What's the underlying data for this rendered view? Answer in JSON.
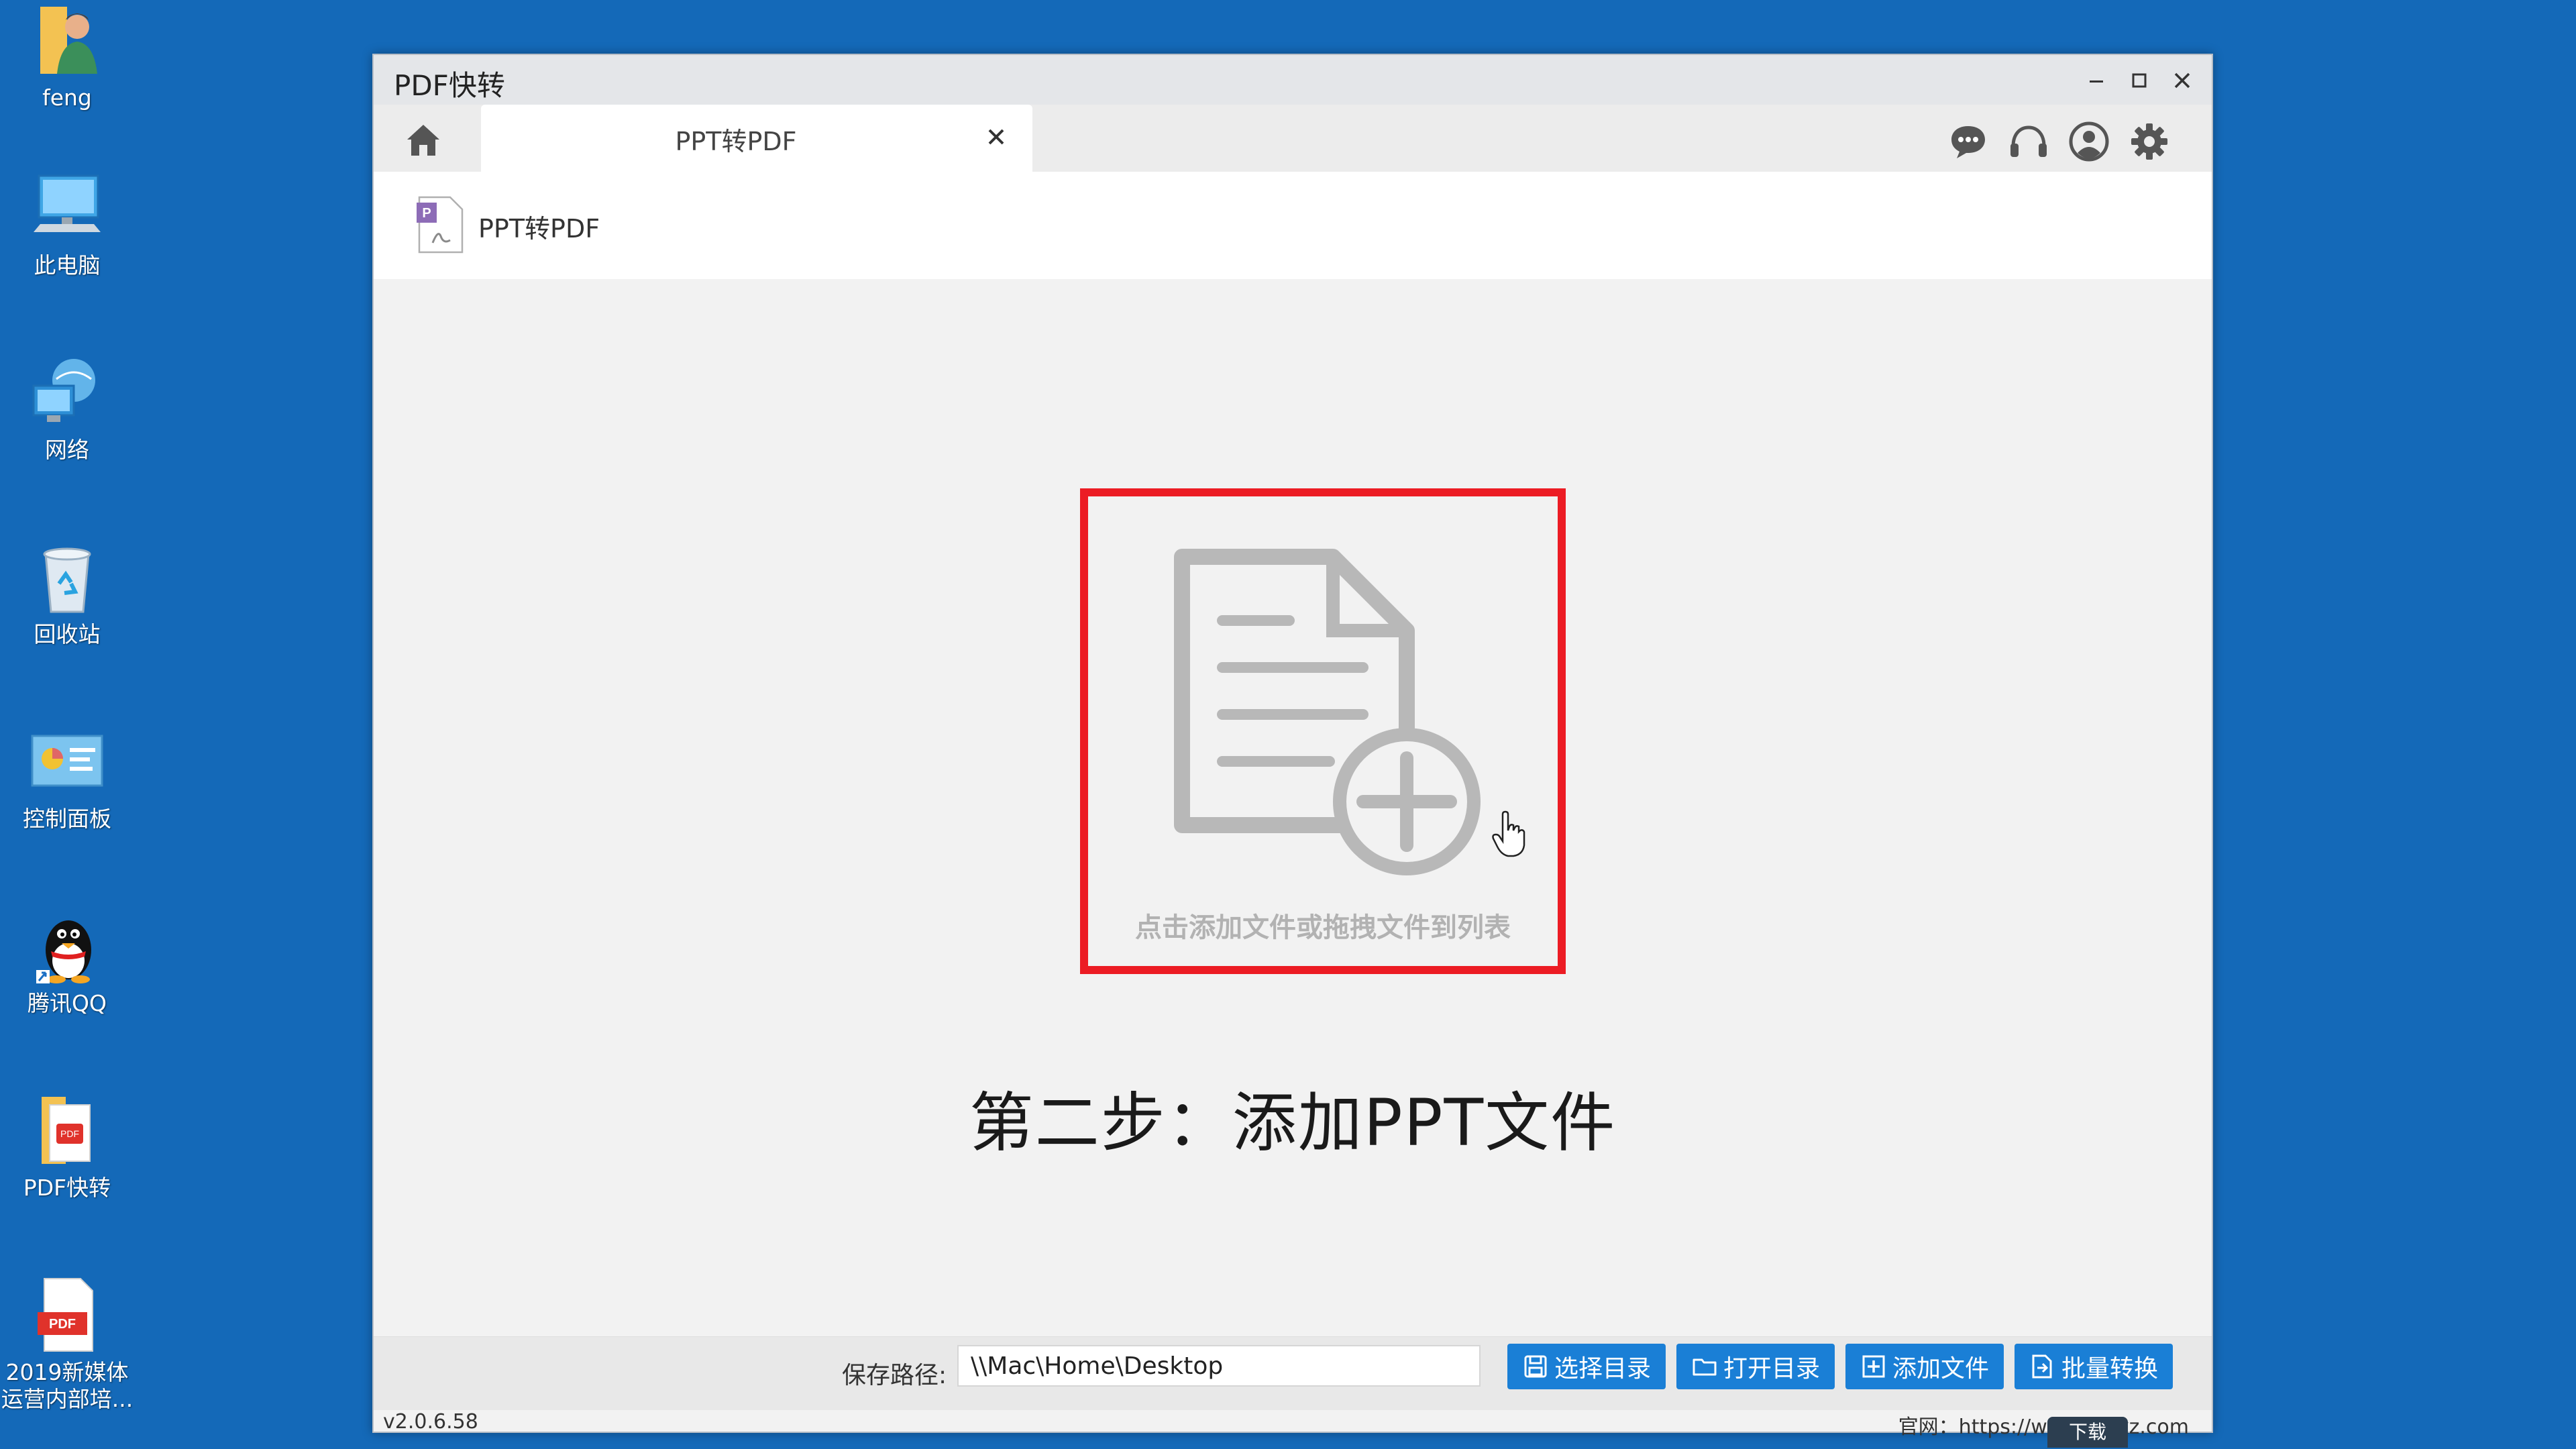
{
  "desktop": {
    "icons": [
      {
        "label": "feng",
        "icon": "user-folder-icon"
      },
      {
        "label": "此电脑",
        "icon": "computer-icon"
      },
      {
        "label": "网络",
        "icon": "network-icon"
      },
      {
        "label": "回收站",
        "icon": "recycle-bin-icon"
      },
      {
        "label": "控制面板",
        "icon": "control-panel-icon"
      },
      {
        "label": "腾讯QQ",
        "icon": "qq-icon"
      },
      {
        "label": "PDF快转",
        "icon": "pdf-converter-icon"
      },
      {
        "label": "2019新媒体\n运营内部培...",
        "icon": "pdf-file-icon"
      }
    ]
  },
  "window": {
    "title": "PDF快转",
    "tab": {
      "label": "PPT转PDF"
    },
    "subheader_title": "PPT转PDF",
    "drop_zone_hint": "点击添加文件或拖拽文件到列表",
    "step_caption": "第二步：添加PPT文件",
    "save_path_label": "保存路径:",
    "save_path_value": "\\\\Mac\\Home\\Desktop",
    "buttons": {
      "select_dir": "选择目录",
      "open_dir": "打开目录",
      "add_file": "添加文件",
      "batch_convert": "批量转换"
    },
    "version": "v2.0.6.58",
    "website": "官网：https://www.pdfkz.com",
    "download_label": "下载"
  },
  "colors": {
    "desktop_bg": "#1469b8",
    "accent_blue": "#1a7fd6",
    "highlight_red": "#ec1c24"
  }
}
